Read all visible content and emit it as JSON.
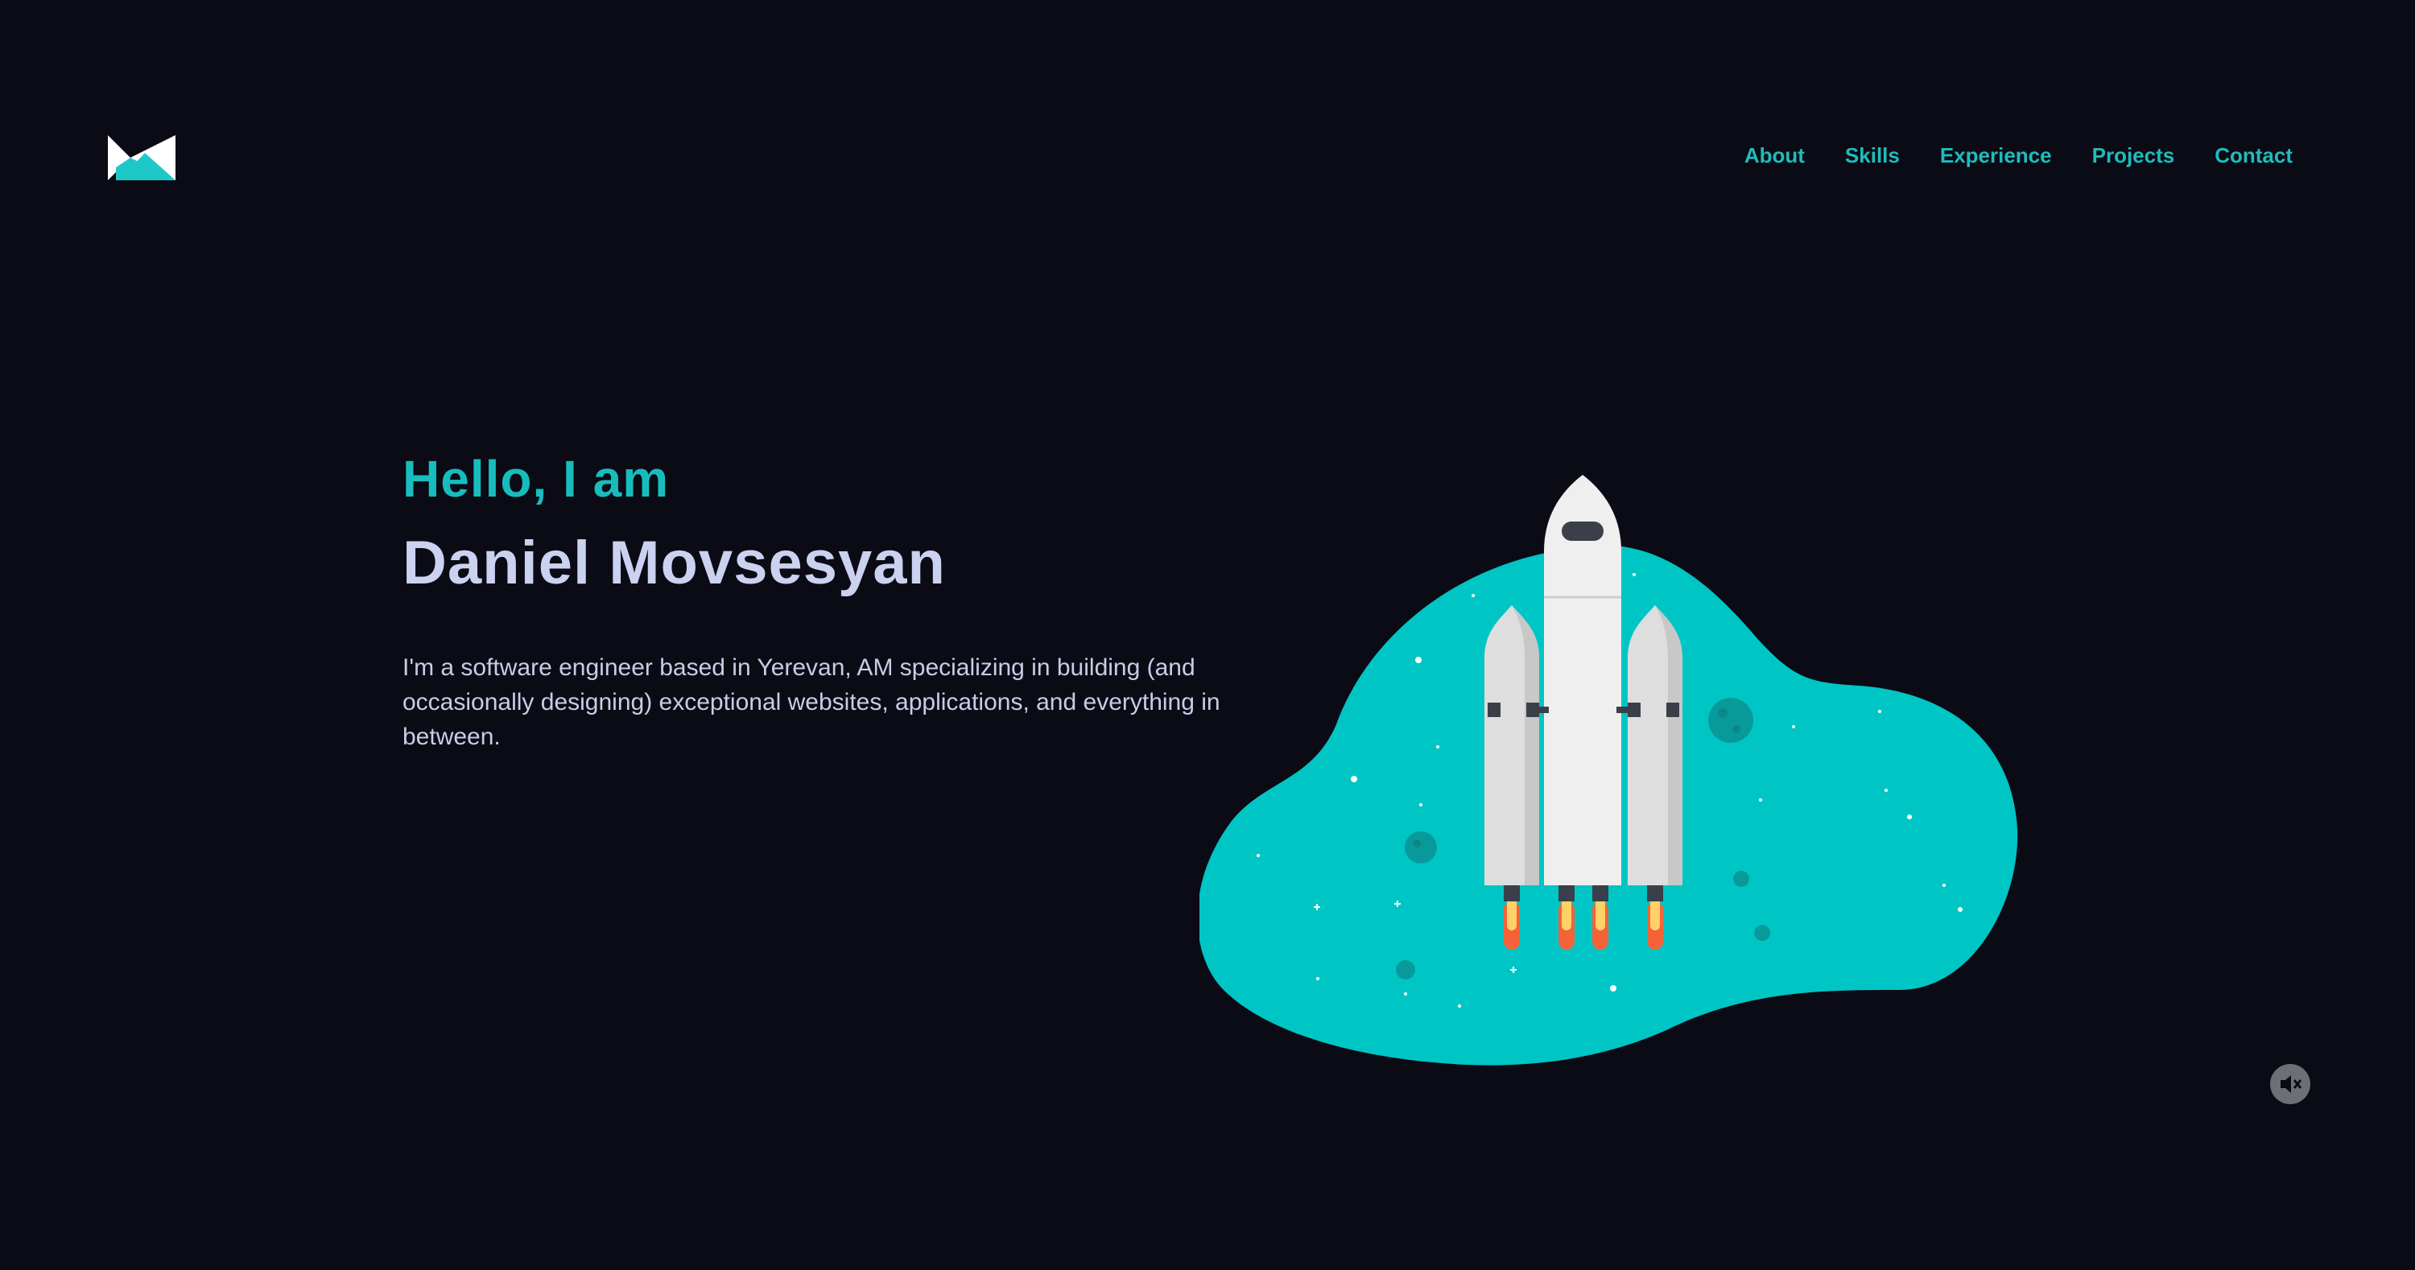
{
  "nav": {
    "items": [
      {
        "label": "About"
      },
      {
        "label": "Skills"
      },
      {
        "label": "Experience"
      },
      {
        "label": "Projects"
      },
      {
        "label": "Contact"
      }
    ]
  },
  "hero": {
    "greeting": "Hello, I am",
    "name": "Daniel Movsesyan",
    "bio": "I'm a software engineer based in Yerevan, AM specializing in building (and occasionally designing) exceptional websites, applications, and everything in between."
  },
  "icons": {
    "logo": "logo-icon",
    "illustration": "rocket-illustration",
    "mute": "speaker-muted-icon"
  },
  "colors": {
    "background": "#0a0b14",
    "accent": "#1fbcbc",
    "blob": "#00c5c5",
    "text_primary": "#cbd2f0",
    "text_secondary": "#c7cde6"
  }
}
